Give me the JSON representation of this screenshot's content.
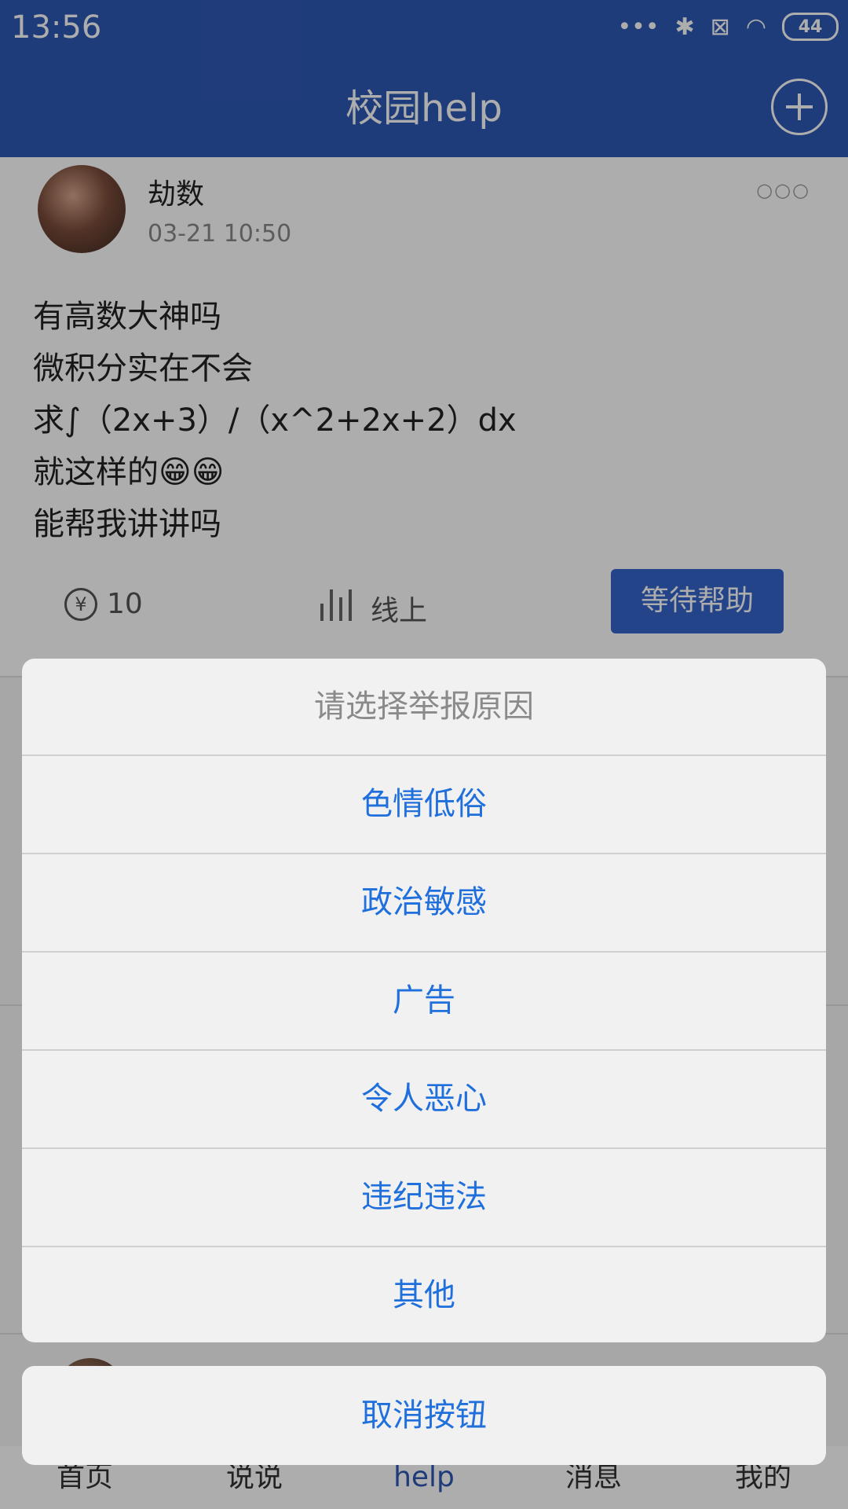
{
  "status_bar": {
    "time": "13:56",
    "battery": "44"
  },
  "header": {
    "title": "校园help"
  },
  "post": {
    "user": "劫数",
    "time": "03-21  10:50",
    "lines": [
      "有高数大神吗",
      "微积分实在不会",
      "求∫（2x+3）/（x^2+2x+2）dx",
      "就这样的😁😁",
      "能帮我讲讲吗"
    ],
    "reward": "10",
    "mode": "线上",
    "status_button": "等待帮助"
  },
  "report_sheet": {
    "title": "请选择举报原因",
    "options": [
      "色情低俗",
      "政治敏感",
      "广告",
      "令人恶心",
      "违纪违法",
      "其他"
    ],
    "cancel": "取消按钮"
  },
  "bottom_nav": [
    "首页",
    "说说",
    "help",
    "消息",
    "我的"
  ],
  "colors": {
    "primary": "#2f59b4",
    "action_text": "#1f6fdc",
    "overlay": "rgba(0,0,0,0.32)"
  }
}
